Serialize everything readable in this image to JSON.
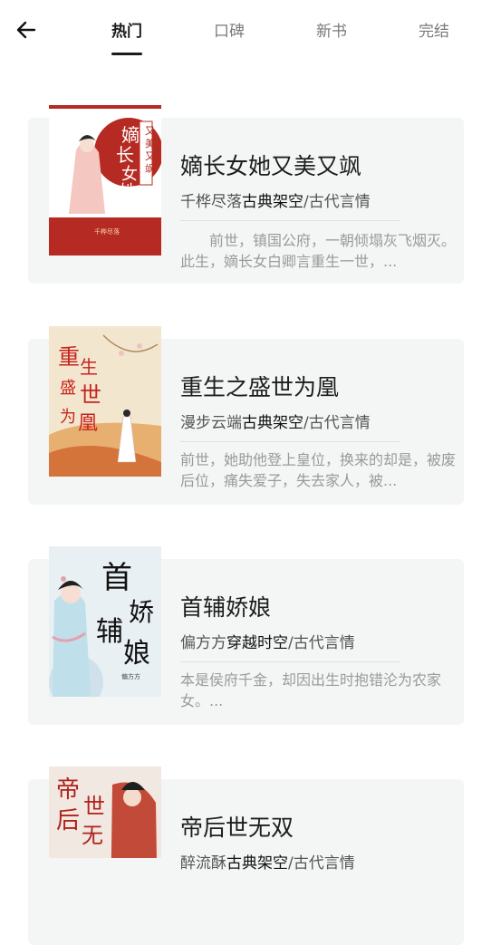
{
  "header": {
    "back_icon": "arrow-left-icon",
    "tabs": [
      {
        "label": "热门",
        "active": true
      },
      {
        "label": "口碑",
        "active": false
      },
      {
        "label": "新书",
        "active": false
      },
      {
        "label": "完结",
        "active": false
      }
    ]
  },
  "books": [
    {
      "title": "嫡长女她又美又飒",
      "author": "千桦尽落",
      "category": "古典架空",
      "genre": "/古代言情",
      "summary": "前世，镇国公府，一朝倾塌灰飞烟灭。此生，嫡长女白卿言重生一世，...",
      "cover_text": "嫡长女她",
      "cover_sub": "又美又飒",
      "cover_author": "千桦尽落"
    },
    {
      "title": "重生之盛世为凰",
      "author": "漫步云端",
      "category": "古典架空",
      "genre": "/古代言情",
      "summary": "前世，她助他登上皇位，换来的却是，被废后位，痛失爱子，失去家人，被...",
      "cover_text": "重生之盛世为凰"
    },
    {
      "title": "首辅娇娘",
      "author": "偏方方",
      "category": "穿越时空",
      "genre": "/古代言情",
      "summary": "本是侯府千金，却因出生时抱错沦为农家女。...",
      "cover_text": "首辅娇娘",
      "cover_author": "偏方方"
    },
    {
      "title": "帝后世无双",
      "author": "醉流酥",
      "category": "古典架空",
      "genre": "/古代言情",
      "summary": "",
      "cover_text": "帝后世无双"
    }
  ],
  "colors": {
    "card_bg": "#f4f5f5",
    "cover1_red": "#b52a22",
    "cover2_red": "#c8231e"
  }
}
